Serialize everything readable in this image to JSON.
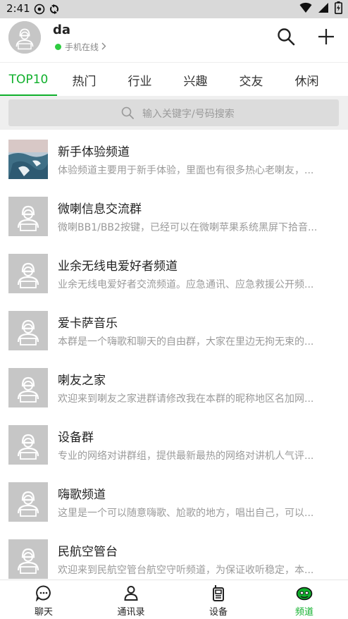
{
  "status_bar": {
    "time": "2:41",
    "icons": [
      "cast-icon",
      "sync-icon",
      "wifi-icon",
      "signal-icon",
      "battery-icon"
    ]
  },
  "header": {
    "username": "da",
    "online_status": "手机在线",
    "status_color": "#2ecc40"
  },
  "tabs": [
    {
      "label": "TOP10",
      "active": true
    },
    {
      "label": "热门",
      "active": false
    },
    {
      "label": "行业",
      "active": false
    },
    {
      "label": "兴趣",
      "active": false
    },
    {
      "label": "交友",
      "active": false
    },
    {
      "label": "休闲",
      "active": false
    }
  ],
  "search": {
    "placeholder": "输入关键字/号码搜索"
  },
  "channels": [
    {
      "title": "新手体验频道",
      "desc": "体验频道主要用于新手体验，里面也有很多热心老喇友，...",
      "thumb": "landscape-photo"
    },
    {
      "title": "微喇信息交流群",
      "desc": "微喇BB1/BB2按键，已经可以在微喇苹果系统黑屏下拾音...",
      "thumb": "default-avatar"
    },
    {
      "title": "业余无线电爱好者频道",
      "desc": "业余无线电爱好者交流频道。应急通讯、应急救援公开频...",
      "thumb": "default-avatar"
    },
    {
      "title": "爱卡萨音乐",
      "desc": "本群是一个嗨歌和聊天的自由群，大家在里边无拘无束的...",
      "thumb": "default-avatar"
    },
    {
      "title": "喇友之家",
      "desc": "欢迎来到喇友之家进群请修改我在本群的昵称地区名加网...",
      "thumb": "default-avatar"
    },
    {
      "title": "设备群",
      "desc": "专业的网络对讲群组，提供最新最热的网络对讲机人气评...",
      "thumb": "default-avatar"
    },
    {
      "title": "嗨歌频道",
      "desc": "这里是一个可以随意嗨歌、尬歌的地方，唱出自己，可以...",
      "thumb": "default-avatar"
    },
    {
      "title": "民航空管台",
      "desc": "欢迎来到民航空管台航空守听频道，为保证收听稳定，本...",
      "thumb": "default-avatar"
    }
  ],
  "bottom_nav": [
    {
      "label": "聊天",
      "icon": "chat-icon",
      "active": false
    },
    {
      "label": "通讯录",
      "icon": "contacts-icon",
      "active": false
    },
    {
      "label": "设备",
      "icon": "walkie-talkie-icon",
      "active": false
    },
    {
      "label": "频道",
      "icon": "channel-icon",
      "active": true
    }
  ],
  "colors": {
    "accent": "#10b02c",
    "placeholder_gray": "#c6c6c6",
    "status_bar": "#d9d9d9"
  }
}
